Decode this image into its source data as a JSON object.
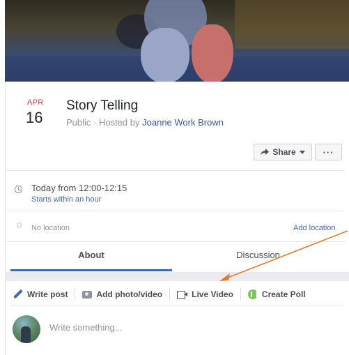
{
  "event": {
    "month": "APR",
    "day": "16",
    "title": "Story Telling",
    "privacy": "Public",
    "hosted_by_prefix": " · Hosted by ",
    "host_name": "Joanne Work Brown"
  },
  "actions": {
    "share_label": "Share",
    "more_label": "···"
  },
  "details": {
    "time_main": "Today from 12:00-12:15",
    "time_sub": "Starts within an hour",
    "location": "No location",
    "add_location": "Add location"
  },
  "tabs": [
    {
      "label": "About",
      "active": true
    },
    {
      "label": "Discussion",
      "active": false
    }
  ],
  "composer": {
    "items": [
      {
        "label": "Write post",
        "icon": "pencil-icon"
      },
      {
        "label": "Add photo/video",
        "icon": "photo-icon"
      },
      {
        "label": "Live Video",
        "icon": "video-camera-icon"
      },
      {
        "label": "Create Poll",
        "icon": "poll-icon"
      }
    ],
    "placeholder": "Write something..."
  },
  "colors": {
    "accent": "#4267b2",
    "date_red": "#e0393e",
    "annotation_arrow": "#e87a2e"
  }
}
